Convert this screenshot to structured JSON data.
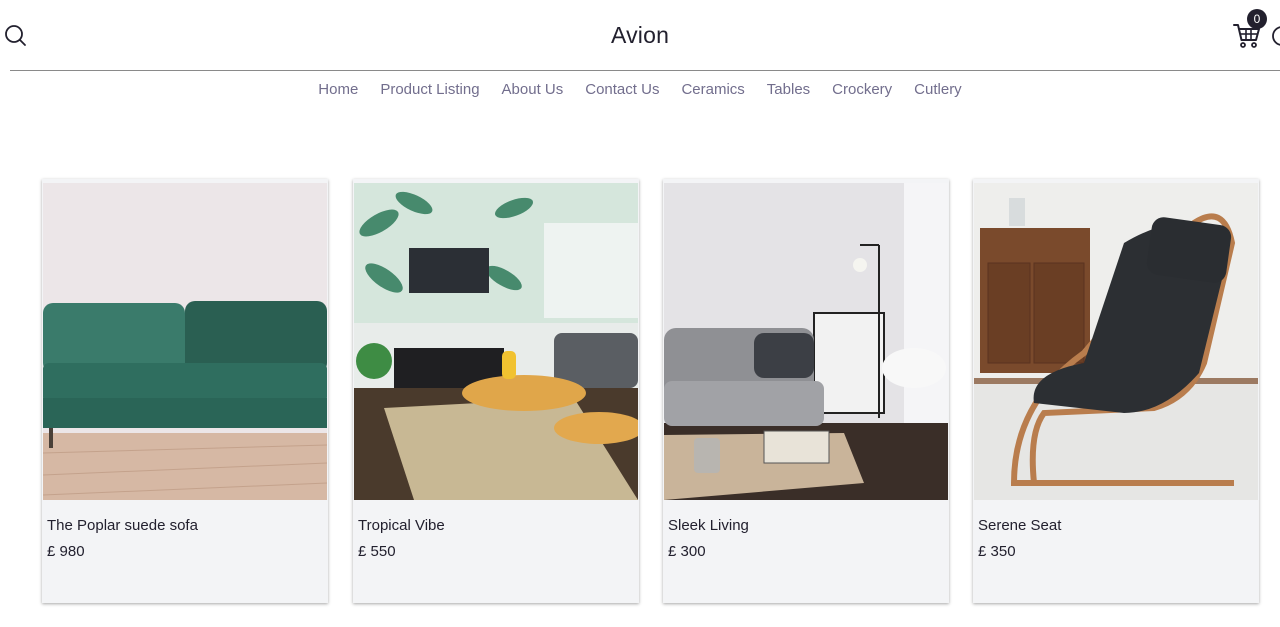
{
  "brand": "Avion",
  "cart": {
    "count": "0"
  },
  "icons": {
    "search": "search-icon",
    "cart": "cart-icon",
    "user": "user-icon"
  },
  "nav": [
    {
      "label": "Home"
    },
    {
      "label": "Product Listing"
    },
    {
      "label": "About Us"
    },
    {
      "label": "Contact Us"
    },
    {
      "label": "Ceramics"
    },
    {
      "label": "Tables"
    },
    {
      "label": "Crockery"
    },
    {
      "label": "Cutlery"
    }
  ],
  "products": [
    {
      "name": "The Poplar suede sofa",
      "price": "£ 980"
    },
    {
      "name": "Tropical Vibe",
      "price": "£ 550"
    },
    {
      "name": "Sleek Living",
      "price": "£ 300"
    },
    {
      "name": "Serene Seat",
      "price": "£ 350"
    }
  ],
  "colors": {
    "text": "#22202e",
    "nav": "#726e8d",
    "card_bg": "#f3f4f6",
    "sofa_green": "#2f6b5c"
  }
}
